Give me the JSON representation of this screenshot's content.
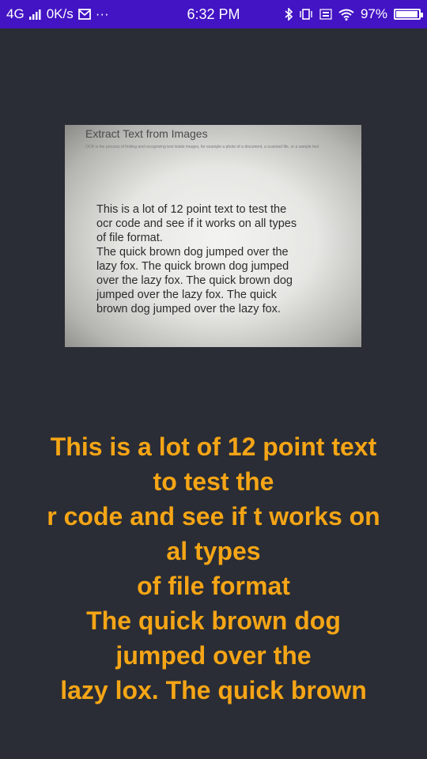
{
  "status_bar": {
    "network": "4G",
    "speed": "0K/s",
    "overflow": "···",
    "time": "6:32 PM",
    "battery_percent": "97%",
    "battery_level": 0.97,
    "colors": {
      "background": "#4314c4",
      "text": "#ffffff"
    },
    "icons": [
      "signal-icon",
      "mail-icon",
      "bluetooth-icon",
      "vibrate-icon",
      "volte-icon",
      "wifi-icon",
      "battery-icon"
    ]
  },
  "photo": {
    "title": "Extract Text from Images",
    "caption": "OCR is the process of finding and recognizing text inside images, for example a photo of a document, a scanned file, or a sample text",
    "body": "This is a lot of 12 point text to test the\nocr code and see if it works on  all types\nof file format.\nThe quick brown dog jumped over the\nlazy fox. The quick brown dog jumped\nover the lazy fox. The quick brown dog\njumped over the lazy fox. The quick\nbrown dog jumped over the lazy fox."
  },
  "ocr_result": {
    "text": "This is a lot of 12 point text\nto test the\nr code and see if t works on\nal types\nof file format\nThe quick brown dog\njumped over the\nlazy lox. The quick brown\ndog jumped",
    "color": "#f5a516"
  },
  "colors": {
    "background": "#2a2d35"
  }
}
